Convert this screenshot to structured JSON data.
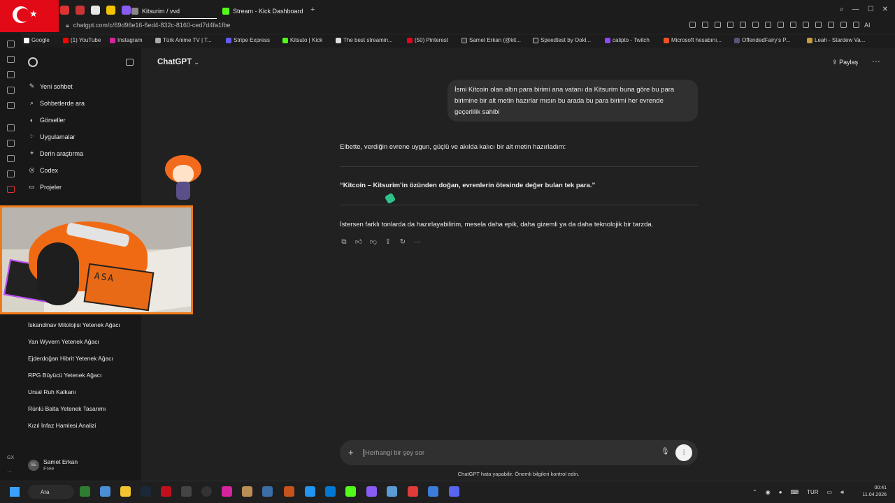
{
  "browser": {
    "tabs": [
      {
        "label": "Kitsurim / vvd",
        "active": true
      },
      {
        "label": "Stream - Kick Dashboard",
        "active": false
      }
    ],
    "url": "chatgpt.com/c/69d96e16-6ed4-832c-8160-ced7d4fa1fbe",
    "extension_ai": "AI"
  },
  "bookmarks": [
    "Google",
    "(1) YouTube",
    "Instagram",
    "Türk Anime TV | T...",
    "Stripe Express",
    "Kitsuto | Kick",
    "The best streamin...",
    "(50) Pinterest",
    "Samet Erkan (@kit...",
    "Speedtest by Ookl...",
    "calipto - Twitch",
    "Microsoft hesabını...",
    "OffendedFairy's P...",
    "Leah - Stardew Va..."
  ],
  "sidebar": {
    "nav": [
      {
        "label": "Yeni sohbet",
        "icon": "edit-icon"
      },
      {
        "label": "Sohbetlerde ara",
        "icon": "search-icon"
      },
      {
        "label": "Görseller",
        "icon": "image-icon"
      },
      {
        "label": "Uygulamalar",
        "icon": "apps-icon"
      },
      {
        "label": "Derin araştırma",
        "icon": "telescope-icon"
      },
      {
        "label": "Codex",
        "icon": "codex-icon"
      },
      {
        "label": "Projeler",
        "icon": "folder-icon"
      }
    ],
    "history": [
      "İskandinav Mitolojisi Yetenek Ağacı",
      "Yan Wyvern Yetenek Ağacı",
      "Ejderdoğan Hibrit Yetenek Ağacı",
      "RPG Büyücü Yetenek Ağacı",
      "Ursal Ruh Kalkanı",
      "Rünlü Balta Yetenek Tasarımı",
      "Kızıl İnfaz Hamlesi Analizi"
    ],
    "user": {
      "initials": "SE",
      "name": "Samet Erkan",
      "plan": "Free"
    },
    "gx_label": "GX",
    "more_label": "···"
  },
  "header": {
    "title": "ChatGPT",
    "share_label": "Paylaş"
  },
  "chat": {
    "user_message": "İsmi Kitcoin olan altın para birimi ana vatanı da Kitsurim buna göre bu para birimine bir alt metin hazırlar mısın bu arada bu para birimi her evrende geçerlilik sahibi",
    "reply_intro": "Elbette, verdiğin evrene uygun, güçlü ve akılda kalıcı bir alt metin hazırladım:",
    "reply_quote": "“Kitcoin – Kitsurim’in özünden doğan, evrenlerin ötesinde değer bulan tek para.”",
    "reply_outro": "İstersen farklı tonlarda da hazırlayabilirim, mesela daha epik, daha gizemli ya da daha teknolojik bir tarzda."
  },
  "composer": {
    "placeholder": "Herhangi bir şey sor"
  },
  "disclaimer": "ChatGPT hata yapabilir. Önemli bilgileri kontrol edin.",
  "taskbar": {
    "search_label": "Ara",
    "language": "TUR",
    "time": "00:41",
    "date": "11.04.2026"
  },
  "overlay": {
    "box_text": "ASA"
  },
  "colors": {
    "accent_orange": "#f07a1a",
    "background": "#212121",
    "sidebar": "#181818",
    "bubble": "#303030"
  }
}
